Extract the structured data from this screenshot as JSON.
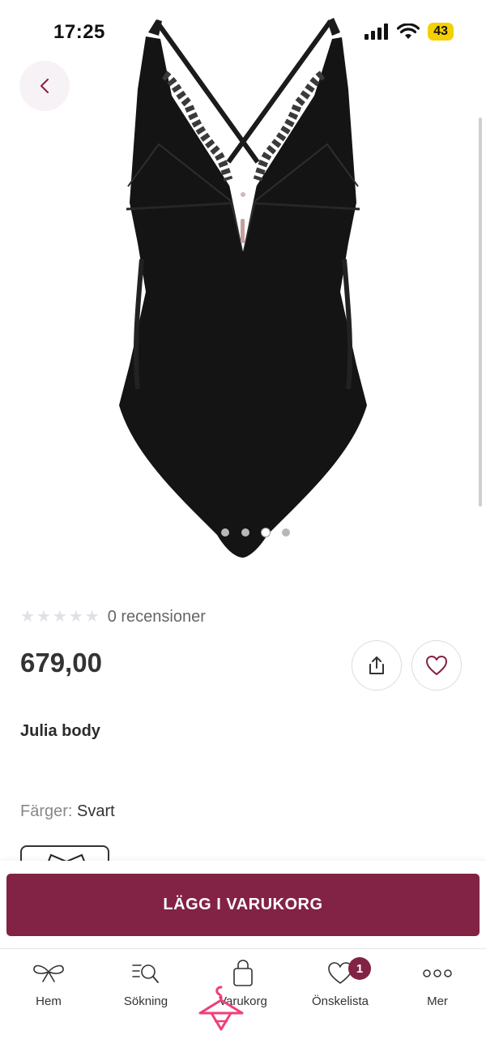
{
  "status": {
    "time": "17:25",
    "battery": "43",
    "icons": [
      "signal-icon",
      "wifi-icon",
      "battery-icon"
    ]
  },
  "navigation": {
    "back_icon": "chevron-left-icon"
  },
  "gallery": {
    "image_count": 4,
    "active_index": 2
  },
  "product": {
    "rating": 0,
    "max_rating": 5,
    "reviews_text": "0 recensioner",
    "price": "679,00",
    "name": "Julia body",
    "colors_label": "Färger:",
    "color_value": "Svart"
  },
  "actions": {
    "share_icon": "share-icon",
    "wishlist_icon": "heart-icon",
    "add_to_cart": "LÄGG I VARUKORG"
  },
  "tabbar": {
    "items": [
      {
        "label": "Hem",
        "icon": "bow-icon"
      },
      {
        "label": "Sökning",
        "icon": "search-list-icon"
      },
      {
        "label": "Varukorg",
        "icon": "bag-icon"
      },
      {
        "label": "Önskelista",
        "icon": "heart-icon",
        "badge": "1"
      },
      {
        "label": "Mer",
        "icon": "more-dots-icon"
      }
    ]
  },
  "colors": {
    "brand": "#822244",
    "logo_pink": "#ee3f7c",
    "garment": "#141414"
  }
}
